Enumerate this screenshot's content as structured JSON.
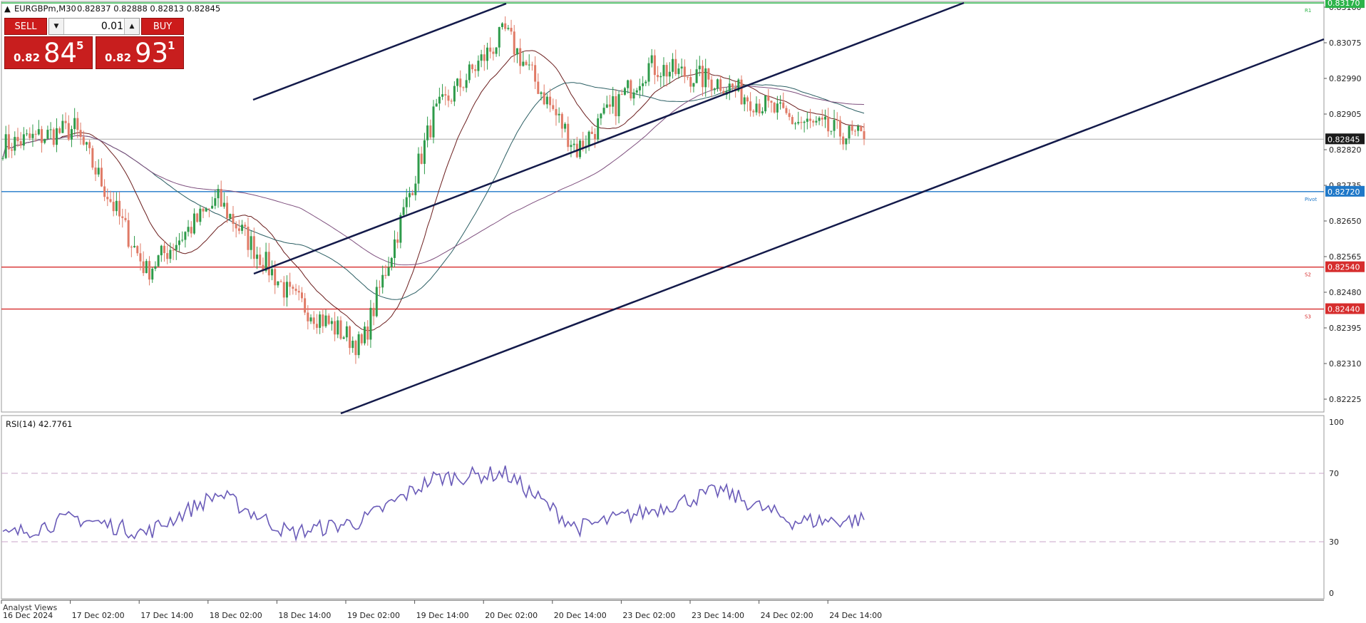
{
  "header": {
    "symbol": "EURGBPm,M30",
    "ohlc": "0.82837 0.82888 0.82813 0.82845"
  },
  "trade_panel": {
    "sell_label": "SELL",
    "buy_label": "BUY",
    "lot_value": "0.01",
    "sell_price": {
      "prefix": "0.82",
      "big": "84",
      "sup": "5"
    },
    "buy_price": {
      "prefix": "0.82",
      "big": "93",
      "sup": "1"
    }
  },
  "price_axis": {
    "ticks": [
      "0.83160",
      "0.83075",
      "0.82990",
      "0.82905",
      "0.82820",
      "0.82735",
      "0.82650",
      "0.82565",
      "0.82480",
      "0.82395",
      "0.82310",
      "0.82225"
    ],
    "current_price": "0.82845",
    "levels": [
      {
        "name": "R1",
        "value": "0.83170",
        "color": "#2db34a"
      },
      {
        "name": "Pivot",
        "value": "0.82720",
        "color": "#1f78c8"
      },
      {
        "name": "S2",
        "value": "0.82540",
        "color": "#d62d2d"
      },
      {
        "name": "S3",
        "value": "0.82440",
        "color": "#d62d2d"
      }
    ]
  },
  "rsi": {
    "label": "RSI(14) 42.7761",
    "ticks": [
      "100",
      "70",
      "30",
      "0"
    ]
  },
  "time_axis": {
    "labels": [
      "16 Dec 2024",
      "17 Dec 02:00",
      "17 Dec 14:00",
      "18 Dec 02:00",
      "18 Dec 14:00",
      "19 Dec 02:00",
      "19 Dec 14:00",
      "20 Dec 02:00",
      "20 Dec 14:00",
      "23 Dec 02:00",
      "23 Dec 14:00",
      "24 Dec 02:00",
      "24 Dec 14:00"
    ]
  },
  "bottom_tab": "Analyst Views",
  "chart_data": {
    "type": "candlestick",
    "title": "EURGBPm,M30",
    "price_range": [
      0.8219,
      0.8319
    ],
    "rsi_range": [
      0,
      100
    ],
    "key_points_price": [
      {
        "t": "16 Dec 2024",
        "close": 0.8283
      },
      {
        "t": "17 Dec 02:00",
        "close": 0.8287
      },
      {
        "t": "17 Dec 14:00",
        "close": 0.8253
      },
      {
        "t": "18 Dec 02:00",
        "close": 0.827
      },
      {
        "t": "18 Dec 14:00",
        "close": 0.8247
      },
      {
        "t": "19 Dec 02:00",
        "close": 0.8235
      },
      {
        "t": "19 Dec 14:00",
        "close": 0.829
      },
      {
        "t": "20 Dec 02:00",
        "close": 0.831
      },
      {
        "t": "20 Dec 14:00",
        "close": 0.8282
      },
      {
        "t": "23 Dec 02:00",
        "close": 0.8302
      },
      {
        "t": "23 Dec 14:00",
        "close": 0.8298
      },
      {
        "t": "24 Dec 02:00",
        "close": 0.8289
      },
      {
        "t": "24 Dec 14:00",
        "close": 0.82845
      }
    ],
    "key_points_rsi": [
      {
        "t": "16 Dec 2024",
        "value": 33
      },
      {
        "t": "17 Dec 02:00",
        "value": 44
      },
      {
        "t": "17 Dec 14:00",
        "value": 35
      },
      {
        "t": "18 Dec 02:00",
        "value": 58
      },
      {
        "t": "18 Dec 14:00",
        "value": 35
      },
      {
        "t": "19 Dec 02:00",
        "value": 42
      },
      {
        "t": "19 Dec 14:00",
        "value": 67
      },
      {
        "t": "20 Dec 02:00",
        "value": 70
      },
      {
        "t": "20 Dec 14:00",
        "value": 38
      },
      {
        "t": "23 Dec 02:00",
        "value": 48
      },
      {
        "t": "23 Dec 14:00",
        "value": 60
      },
      {
        "t": "24 Dec 02:00",
        "value": 42
      },
      {
        "t": "24 Dec 14:00",
        "value": 42.78
      }
    ],
    "rsi_levels": [
      70,
      30
    ]
  }
}
